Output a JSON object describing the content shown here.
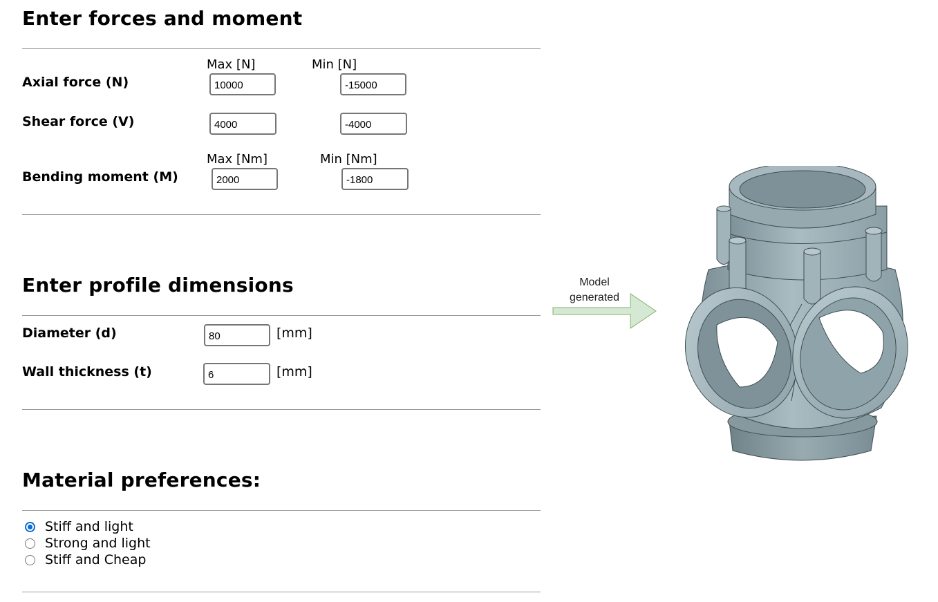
{
  "forces": {
    "title": "Enter forces and moment",
    "max_n_label": "Max [N]",
    "min_n_label": "Min [N]",
    "max_nm_label": "Max [Nm]",
    "min_nm_label": "Min [Nm]",
    "axial": {
      "label": "Axial force (N)",
      "max": "10000",
      "min": "-15000"
    },
    "shear": {
      "label": "Shear force (V)",
      "max": "4000",
      "min": "-4000"
    },
    "bending": {
      "label": "Bending moment (M)",
      "max": "2000",
      "min": "-1800"
    }
  },
  "profile": {
    "title": "Enter profile dimensions",
    "diameter": {
      "label": "Diameter (d)",
      "value": "80",
      "unit": "[mm]"
    },
    "thickness": {
      "label": "Wall thickness (t)",
      "value": "6",
      "unit": "[mm]"
    }
  },
  "material": {
    "title": "Material preferences:",
    "options": [
      {
        "label": "Stiff and light",
        "checked": true
      },
      {
        "label": "Strong and light",
        "checked": false
      },
      {
        "label": "Stiff and Cheap",
        "checked": false
      }
    ]
  },
  "model": {
    "arrow_line1": "Model",
    "arrow_line2": "generated",
    "arrow_color": "#d5e8d4",
    "arrow_border": "#82b366",
    "part_color": "#9fb3ba"
  }
}
